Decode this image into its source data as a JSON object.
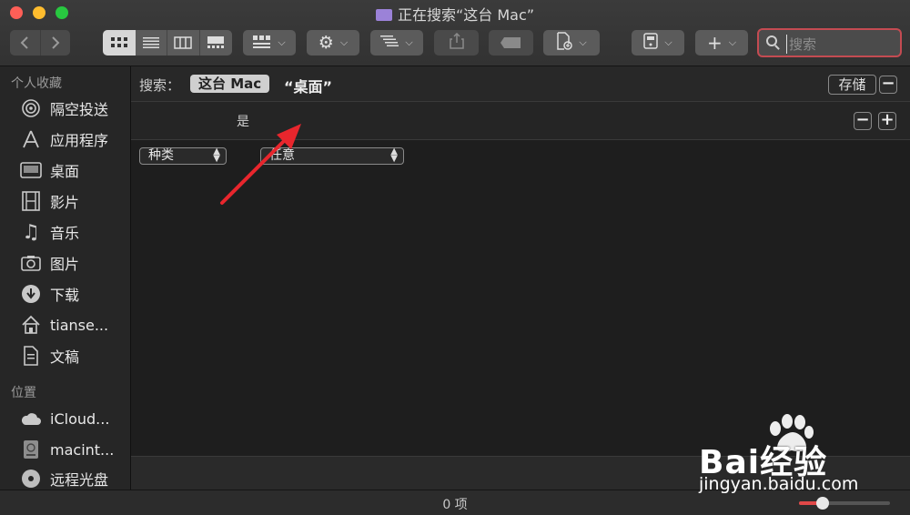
{
  "window": {
    "title": "正在搜索“这台 Mac”"
  },
  "toolbar": {
    "search_placeholder": "搜索",
    "icons": [
      "back-icon",
      "forward-icon",
      "icon-view-icon",
      "list-view-icon",
      "column-view-icon",
      "gallery-view-icon",
      "group-icon",
      "action-gear-icon",
      "arrange-icon",
      "share-icon",
      "tag-icon",
      "document-plus-icon",
      "drive-icon",
      "plus-icon",
      "search-icon"
    ]
  },
  "sidebar": {
    "favorites_title": "个人收藏",
    "favorites": [
      {
        "label": "隔空投送",
        "icon": "airdrop-icon"
      },
      {
        "label": "应用程序",
        "icon": "applications-icon"
      },
      {
        "label": "桌面",
        "icon": "desktop-icon"
      },
      {
        "label": "影片",
        "icon": "movies-icon"
      },
      {
        "label": "音乐",
        "icon": "music-icon"
      },
      {
        "label": "图片",
        "icon": "pictures-icon"
      },
      {
        "label": "下载",
        "icon": "downloads-icon"
      },
      {
        "label": "tianse...",
        "icon": "home-icon"
      },
      {
        "label": "文稿",
        "icon": "documents-icon"
      }
    ],
    "locations_title": "位置",
    "locations": [
      {
        "label": "iCloud...",
        "icon": "icloud-icon"
      },
      {
        "label": "macint...",
        "icon": "hard-drive-icon"
      },
      {
        "label": "远程光盘",
        "icon": "disc-icon"
      }
    ]
  },
  "searchbar": {
    "search_label": "搜索：",
    "scope_selected": "这台 Mac",
    "scope_other": "“桌面”",
    "save_label": "存储",
    "minus": "−",
    "plus": "+"
  },
  "criteria": {
    "attribute": "种类",
    "operator": "是",
    "value": "任意"
  },
  "status": {
    "item_count": "0 项"
  },
  "watermark": {
    "logo_text": "Bai经验",
    "url": "jingyan.baidu.com"
  }
}
